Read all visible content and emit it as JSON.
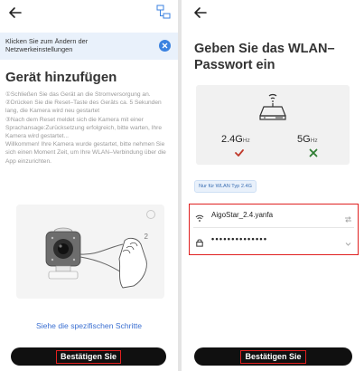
{
  "left": {
    "banner_text": "Klicken Sie zum Ändern der Netzwerkeinstellungen",
    "title": "Gerät hinzufügen",
    "instructions": [
      "①Schließen Sie das Gerät an die Stromversorgung an.",
      "②Drücken Sie die Reset–Taste des Geräts ca. 5 Sekunden lang, die Kamera wird neu gestartet",
      "③Nach dem Reset meldet sich die Kamera mit einer Sprachansage:Zurücksetzung erfolgreich, bitte warten, Ihre Kamera wird gestartet...",
      "Willkommen! Ihre Kamera wurde gestartet, bitte nehmen Sie sich einen Moment Zeit, um Ihre WLAN–Verbindung über die App einzurichten."
    ],
    "illustration_number": "2",
    "steps_link": "Siehe die spezifischen Schritte",
    "confirm_label": "Bestätigen Sie"
  },
  "right": {
    "title": "Geben Sie das WLAN–Passwort ein",
    "band_24": {
      "value": "2.4G",
      "unit": "Hz",
      "supported": true
    },
    "band_5": {
      "value": "5G",
      "unit": "Hz",
      "supported": false
    },
    "wifi_chip": "Nur für WLAN Typ 2.4G",
    "ssid": "AigoStar_2.4.yanfa",
    "password_masked": "••••••••••••••",
    "confirm_label": "Bestätigen Sie"
  },
  "colors": {
    "accent": "#3b82e0",
    "highlight": "#e02020",
    "check": "#c0392b",
    "cross": "#2e7d32",
    "button": "#101010"
  },
  "icons": {
    "back": "arrow-left-icon",
    "network": "network-settings-icon",
    "close": "close-icon",
    "help": "help-icon",
    "router": "router-icon",
    "wifi": "wifi-icon",
    "lock": "lock-icon",
    "switch": "switch-network-icon",
    "dropdown": "chevron-down-icon"
  }
}
